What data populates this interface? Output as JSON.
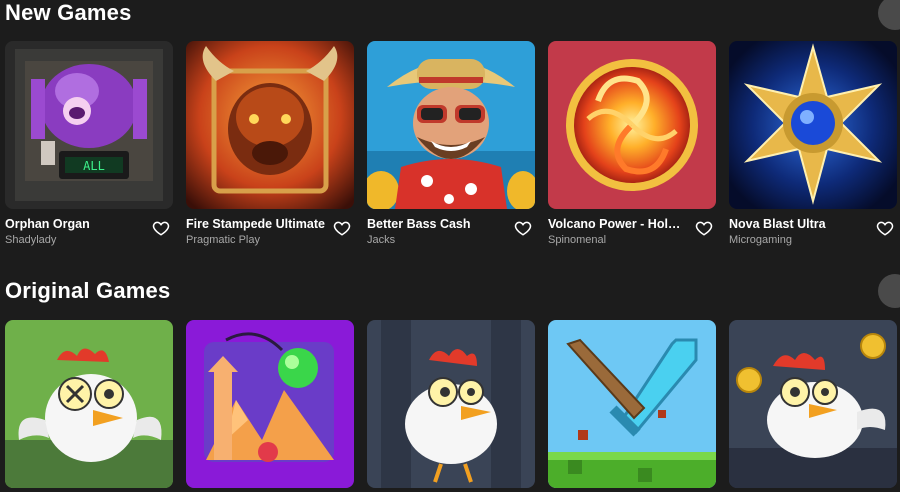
{
  "new_games": {
    "title": "New Games",
    "items": [
      {
        "title": "Orphan Organ",
        "provider": "Shadylady"
      },
      {
        "title": "Fire Stampede Ultimate",
        "provider": "Pragmatic Play"
      },
      {
        "title": "Better Bass Cash",
        "provider": "Jacks"
      },
      {
        "title": "Volcano Power - Hold & ...",
        "provider": "Spinomenal"
      },
      {
        "title": "Nova Blast Ultra",
        "provider": "Microgaming"
      }
    ]
  },
  "original_games": {
    "title": "Original Games"
  },
  "icons": {
    "favorite": "heart-outline-icon",
    "scroll": "scroll-right-button"
  },
  "colors": {
    "background": "#1c1c1c",
    "provider_text": "#a8a8a8"
  }
}
